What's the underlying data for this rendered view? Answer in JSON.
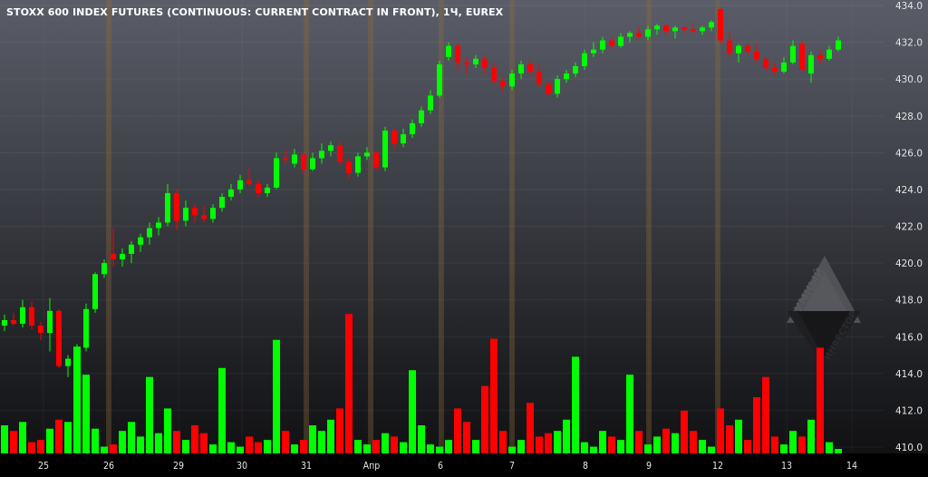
{
  "title": "STOXX 600 INDEX FUTURES (CONTINUOUS: CURRENT CONTRACT IN FRONT), 1Ч, EUREX",
  "watermark": {
    "line1": "УМНЫЙ",
    "line2": "ИНВЕСТОР"
  },
  "colors": {
    "up": "#00ff00",
    "down": "#ff0000",
    "separator": "#8a6a3a"
  },
  "chart_data": {
    "type": "candlestick",
    "title": "STOXX 600 INDEX FUTURES (CONTINUOUS: CURRENT CONTRACT IN FRONT), 1Ч, EUREX",
    "ylim": [
      410,
      434
    ],
    "price_ticks": [
      "434.0",
      "432.0",
      "430.0",
      "428.0",
      "426.0",
      "424.0",
      "422.0",
      "420.0",
      "418.0",
      "416.0",
      "414.0",
      "412.0",
      "410.0"
    ],
    "date_ticks": [
      {
        "label": "25",
        "index": 4.3
      },
      {
        "label": "26",
        "index": 11.5
      },
      {
        "label": "29",
        "index": 19.2
      },
      {
        "label": "30",
        "index": 26.2
      },
      {
        "label": "31",
        "index": 33.3
      },
      {
        "label": "Апр",
        "index": 40.5
      },
      {
        "label": "6",
        "index": 48.1
      },
      {
        "label": "7",
        "index": 56
      },
      {
        "label": "8",
        "index": 64.1
      },
      {
        "label": "9",
        "index": 71.1
      },
      {
        "label": "12",
        "index": 78.7
      },
      {
        "label": "13",
        "index": 86.3
      },
      {
        "label": "14",
        "index": 93.5
      }
    ],
    "day_separators": [
      11.5,
      33.3,
      40.4,
      48.2,
      56,
      71.1,
      78.7
    ],
    "candles": [
      [
        416.6,
        417.2,
        416.3,
        416.9
      ],
      [
        416.9,
        417.3,
        416.6,
        416.7
      ],
      [
        416.7,
        418,
        416.5,
        417.6
      ],
      [
        417.6,
        417.9,
        416.4,
        416.6
      ],
      [
        416.6,
        416.8,
        415.8,
        416.2
      ],
      [
        416.2,
        418.1,
        415.2,
        417.4
      ],
      [
        417.4,
        417.5,
        414.3,
        414.4
      ],
      [
        414.4,
        415,
        413.8,
        414.8
      ],
      [
        414.8,
        415.6,
        414,
        415.4
      ],
      [
        415.4,
        417.8,
        415.2,
        417.5
      ],
      [
        417.5,
        419.5,
        417.3,
        419.4
      ],
      [
        419.4,
        420.2,
        419.2,
        420
      ],
      [
        420.5,
        421.9,
        419.8,
        420.2
      ],
      [
        420.2,
        420.8,
        419.8,
        420.5
      ],
      [
        420.5,
        421.2,
        420,
        421
      ],
      [
        421,
        421.6,
        420.6,
        421.4
      ],
      [
        421.4,
        422.2,
        421,
        421.9
      ],
      [
        421.9,
        422.5,
        421.5,
        422.2
      ],
      [
        422.2,
        424.3,
        422,
        423.8
      ],
      [
        423.8,
        424,
        421.8,
        422.3
      ],
      [
        422.3,
        423.4,
        422,
        423
      ],
      [
        423,
        423.2,
        422.2,
        422.6
      ],
      [
        422.6,
        423.1,
        422.2,
        422.4
      ],
      [
        422.4,
        423.2,
        422.2,
        423
      ],
      [
        423,
        423.8,
        422.8,
        423.6
      ],
      [
        423.6,
        424.3,
        423.4,
        424
      ],
      [
        424,
        424.8,
        423.8,
        424.5
      ],
      [
        424.5,
        425.2,
        424.2,
        424.3
      ],
      [
        424.3,
        424.5,
        423.6,
        423.8
      ],
      [
        423.8,
        424.3,
        423.6,
        424.1
      ],
      [
        424.1,
        426,
        424,
        425.7
      ],
      [
        425.7,
        426.2,
        425.4,
        425.6
      ],
      [
        425.4,
        426.2,
        425.2,
        425.9
      ],
      [
        425.9,
        426,
        424.8,
        425.1
      ],
      [
        425.1,
        426,
        425,
        425.7
      ],
      [
        425.7,
        426.5,
        425.4,
        426.1
      ],
      [
        426.1,
        426.6,
        425.8,
        426.4
      ],
      [
        426.4,
        426.6,
        425.3,
        425.5
      ],
      [
        425.5,
        425.7,
        424.6,
        424.9
      ],
      [
        424.9,
        426,
        424.7,
        425.8
      ],
      [
        425.8,
        426.3,
        425.6,
        426
      ],
      [
        426,
        426.1,
        425,
        425.2
      ],
      [
        425.2,
        427.4,
        425,
        427.2
      ],
      [
        427.2,
        427.3,
        426.2,
        426.5
      ],
      [
        426.5,
        427.3,
        426.3,
        427
      ],
      [
        427,
        427.8,
        426.8,
        427.6
      ],
      [
        427.6,
        428.5,
        427.4,
        428.3
      ],
      [
        428.3,
        429.4,
        428.1,
        429.1
      ],
      [
        429.1,
        431,
        429,
        430.8
      ],
      [
        431.2,
        432,
        431,
        431.8
      ],
      [
        431.8,
        432,
        430.4,
        430.9
      ],
      [
        430.9,
        431.2,
        430.3,
        430.8
      ],
      [
        430.8,
        431.3,
        430.6,
        431.1
      ],
      [
        431.1,
        431.3,
        430.3,
        430.6
      ],
      [
        430.6,
        430.9,
        429.8,
        429.9
      ],
      [
        429.9,
        430.1,
        429.3,
        429.6
      ],
      [
        429.6,
        430.5,
        429.4,
        430.3
      ],
      [
        430.3,
        431,
        430,
        430.8
      ],
      [
        430.8,
        431,
        430.2,
        430.4
      ],
      [
        430.4,
        430.8,
        429.6,
        429.7
      ],
      [
        429.7,
        429.9,
        429.1,
        429.2
      ],
      [
        429.2,
        430.2,
        429,
        430
      ],
      [
        430,
        430.5,
        429.8,
        430.3
      ],
      [
        430.3,
        430.9,
        430.1,
        430.7
      ],
      [
        430.7,
        431.6,
        430.5,
        431.4
      ],
      [
        431.4,
        432,
        431.2,
        431.6
      ],
      [
        431.6,
        432.3,
        431.4,
        432.1
      ],
      [
        432.1,
        432.3,
        431.6,
        431.8
      ],
      [
        431.8,
        432.5,
        431.7,
        432.3
      ],
      [
        432.3,
        432.6,
        432,
        432.5
      ],
      [
        432.5,
        432.8,
        432.2,
        432.3
      ],
      [
        432.3,
        432.9,
        432.1,
        432.7
      ],
      [
        432.7,
        433,
        432.4,
        432.9
      ],
      [
        432.9,
        433,
        432.4,
        432.6
      ],
      [
        432.6,
        432.9,
        432.2,
        432.8
      ],
      [
        432.8,
        432.9,
        432.5,
        432.7
      ],
      [
        432.7,
        433,
        432.5,
        432.6
      ],
      [
        432.6,
        432.9,
        432.4,
        432.8
      ],
      [
        432.8,
        433.2,
        432.6,
        433.1
      ],
      [
        433.8,
        433.9,
        431.9,
        432.1
      ],
      [
        432.1,
        432.6,
        431.2,
        431.4
      ],
      [
        431.4,
        431.9,
        430.9,
        431.8
      ],
      [
        431.8,
        432,
        431.3,
        431.5
      ],
      [
        431.5,
        431.9,
        430.9,
        431.1
      ],
      [
        431.1,
        431.2,
        430.4,
        430.6
      ],
      [
        430.6,
        430.9,
        430.2,
        430.4
      ],
      [
        430.4,
        431.2,
        430.3,
        430.9
      ],
      [
        430.9,
        432.1,
        430.8,
        431.8
      ],
      [
        431.9,
        432.1,
        430.4,
        430.5
      ],
      [
        430.3,
        431.5,
        429.8,
        431.3
      ],
      [
        431.3,
        431.6,
        430.8,
        431.1
      ],
      [
        431.1,
        431.8,
        431,
        431.6
      ],
      [
        431.6,
        432.3,
        431.5,
        432.1
      ]
    ],
    "volume_relative": [
      25,
      20,
      28,
      10,
      12,
      22,
      30,
      28,
      95,
      70,
      22,
      6,
      8,
      20,
      28,
      15,
      68,
      18,
      40,
      20,
      12,
      25,
      18,
      8,
      76,
      10,
      6,
      15,
      10,
      12,
      101,
      20,
      8,
      12,
      25,
      20,
      30,
      40,
      124,
      12,
      8,
      12,
      18,
      15,
      10,
      74,
      25,
      8,
      6,
      12,
      40,
      28,
      12,
      60,
      102,
      20,
      6,
      12,
      45,
      15,
      18,
      20,
      30,
      86,
      10,
      6,
      20,
      15,
      12,
      70,
      20,
      8,
      15,
      22,
      18,
      38,
      20,
      12,
      6,
      40,
      25,
      30,
      12,
      50,
      68,
      15,
      8,
      20,
      15,
      30,
      94,
      10,
      4
    ]
  }
}
